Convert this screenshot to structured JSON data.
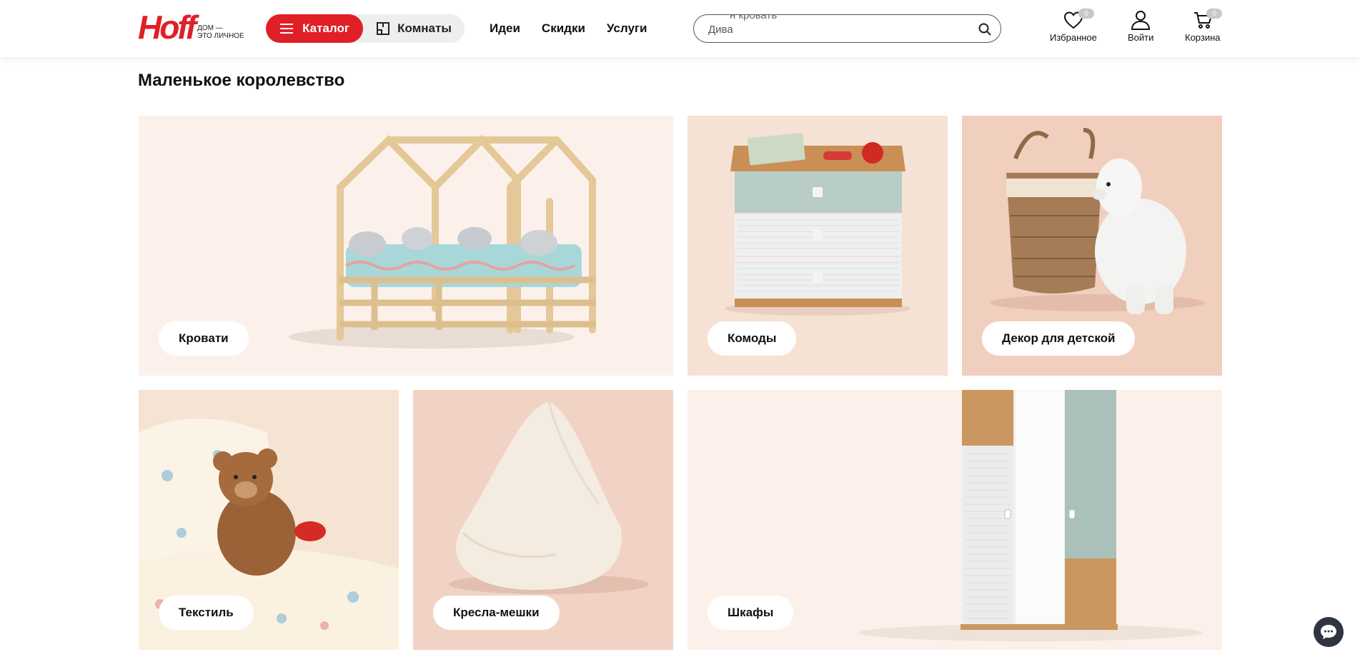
{
  "header": {
    "logo": {
      "word": "Hoff",
      "tagline_1": "ДОМ —",
      "tagline_2": "ЭТО ЛИЧНОЕ"
    },
    "catalog_label": "Каталог",
    "rooms_label": "Комнаты",
    "nav": [
      "Идеи",
      "Скидки",
      "Услуги"
    ],
    "search": {
      "placeholder": "Диван кровать",
      "ghost_top": "н кровать",
      "ghost_bottom": "Дива"
    },
    "favorites": {
      "label": "Избранное",
      "count": "0"
    },
    "login": {
      "label": "Войти"
    },
    "cart": {
      "label": "Корзина",
      "count": "0"
    }
  },
  "section": {
    "title": "Маленькое королевство",
    "tiles": [
      {
        "label": "Кровати",
        "icon": "bed-image"
      },
      {
        "label": "Комоды",
        "icon": "dresser-image"
      },
      {
        "label": "Декор для детской",
        "icon": "decor-image"
      },
      {
        "label": "Текстиль",
        "icon": "textile-image"
      },
      {
        "label": "Кресла-мешки",
        "icon": "beanbag-image"
      },
      {
        "label": "Шкафы",
        "icon": "wardrobe-image"
      }
    ]
  },
  "colors": {
    "brand_red": "#e01f26",
    "tile_light": "#fcf1ea",
    "tile_mid": "#f6e1d5",
    "tile_peach": "#f1cfbf"
  }
}
